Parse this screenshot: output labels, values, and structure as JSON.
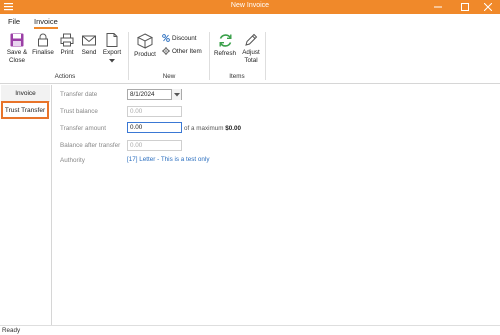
{
  "window": {
    "title": "New Invoice",
    "accent": "#f0892a",
    "buttons": [
      "minimize",
      "maximize",
      "close"
    ]
  },
  "menu": {
    "tabs": [
      {
        "label": "File"
      },
      {
        "label": "Invoice",
        "active": true
      }
    ]
  },
  "ribbon": {
    "actions": {
      "label": "Actions",
      "buttons": [
        {
          "label": "Save &\nClose",
          "icon": "save-icon"
        },
        {
          "label": "Finalise",
          "icon": "lock-icon"
        },
        {
          "label": "Print",
          "icon": "printer-icon"
        },
        {
          "label": "Send",
          "icon": "envelope-icon"
        },
        {
          "label": "Export",
          "icon": "document-icon"
        }
      ]
    },
    "new": {
      "label": "New",
      "product": "Product",
      "discount": "Discount",
      "other_item": "Other Item"
    },
    "items": {
      "label": "Items",
      "refresh": "Refresh",
      "adjust_total": "Adjust\nTotal"
    }
  },
  "sidebar": {
    "items": [
      {
        "label": "Invoice"
      },
      {
        "label": "Trust Transfer",
        "selected": true
      }
    ]
  },
  "form": {
    "transfer_date": {
      "label": "Transfer date",
      "value": "8/1/2024"
    },
    "trust_balance": {
      "label": "Trust balance",
      "value": "0.00"
    },
    "transfer_amount": {
      "label": "Transfer amount",
      "value": "0.00",
      "max_prefix": "of a maximum",
      "max_value": "$0.00"
    },
    "balance_after": {
      "label": "Balance after transfer",
      "value": "0.00"
    },
    "authority": {
      "label": "Authority",
      "value": "[17] Letter - This is a test only"
    }
  },
  "status": {
    "text": "Ready"
  }
}
